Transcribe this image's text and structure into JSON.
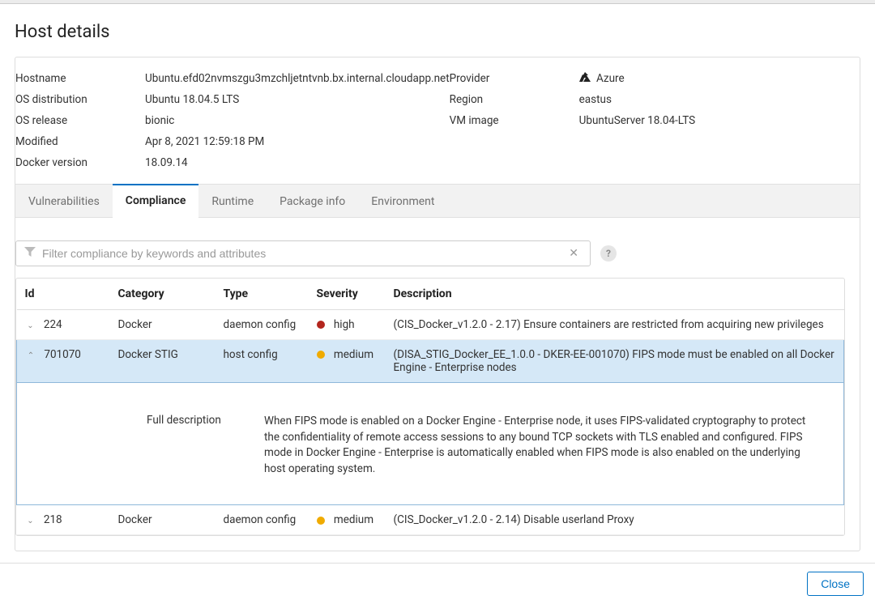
{
  "page_title": "Host details",
  "details_left": [
    {
      "label": "Hostname",
      "value": "Ubuntu.efd02nvmszgu3mzchljetntvnb.bx.internal.cloudapp.net"
    },
    {
      "label": "OS distribution",
      "value": "Ubuntu 18.04.5 LTS"
    },
    {
      "label": "OS release",
      "value": "bionic"
    },
    {
      "label": "Modified",
      "value": "Apr 8, 2021 12:59:18 PM"
    },
    {
      "label": "Docker version",
      "value": "18.09.14"
    }
  ],
  "details_right": [
    {
      "label": "Provider",
      "value": "Azure",
      "icon": "azure"
    },
    {
      "label": "Region",
      "value": "eastus"
    },
    {
      "label": "VM image",
      "value": "UbuntuServer 18.04-LTS"
    }
  ],
  "tabs": [
    {
      "label": "Vulnerabilities",
      "active": false
    },
    {
      "label": "Compliance",
      "active": true
    },
    {
      "label": "Runtime",
      "active": false
    },
    {
      "label": "Package info",
      "active": false
    },
    {
      "label": "Environment",
      "active": false
    }
  ],
  "filter": {
    "placeholder": "Filter compliance by keywords and attributes"
  },
  "columns": {
    "id": "Id",
    "category": "Category",
    "type": "Type",
    "severity": "Severity",
    "description": "Description"
  },
  "rows": [
    {
      "id": "224",
      "category": "Docker",
      "type": "daemon config",
      "severity": "high",
      "description": "(CIS_Docker_v1.2.0 - 2.17) Ensure containers are restricted from acquiring new privileges",
      "expanded": false
    },
    {
      "id": "701070",
      "category": "Docker STIG",
      "type": "host config",
      "severity": "medium",
      "description": "(DISA_STIG_Docker_EE_1.0.0 - DKER-EE-001070) FIPS mode must be enabled on all Docker Engine - Enterprise nodes",
      "expanded": true,
      "full_desc_label": "Full description",
      "full_desc": "When FIPS mode is enabled on a Docker Engine - Enterprise node, it uses FIPS-validated cryptography to protect the confidentiality of remote access sessions to any bound TCP sockets with TLS enabled and configured. FIPS mode in Docker Engine - Enterprise is automatically enabled when FIPS mode is also enabled on the underlying host operating system."
    },
    {
      "id": "218",
      "category": "Docker",
      "type": "daemon config",
      "severity": "medium",
      "description": "(CIS_Docker_v1.2.0 - 2.14) Disable userland Proxy",
      "expanded": false
    }
  ],
  "footer": {
    "close": "Close"
  }
}
